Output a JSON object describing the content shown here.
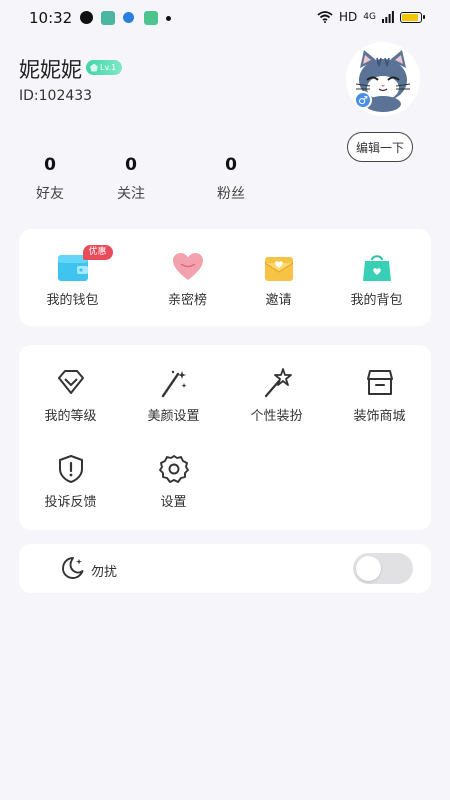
{
  "status_bar": {
    "time": "10:32",
    "network": "HD",
    "signal": "4G",
    "battery_level": 0.9,
    "battery_color": "#f4c400"
  },
  "profile": {
    "username": "妮妮妮",
    "level": "Lv.1",
    "user_id": "ID:102433",
    "gender_symbol": "♂",
    "edit_label": "编辑一下"
  },
  "stats": [
    {
      "value": "0",
      "label": "好友"
    },
    {
      "value": "0",
      "label": "关注"
    },
    {
      "value": "0",
      "label": "粉丝"
    }
  ],
  "quick_menu": {
    "items": [
      {
        "label": "我的钱包",
        "icon": "wallet-icon",
        "badge": "优惠"
      },
      {
        "label": "亲密榜",
        "icon": "heart-icon"
      },
      {
        "label": "邀请",
        "icon": "envelope-icon"
      },
      {
        "label": "我的背包",
        "icon": "bag-icon"
      }
    ]
  },
  "settings_menu": {
    "items": [
      {
        "label": "我的等级",
        "icon": "diamond-icon"
      },
      {
        "label": "美颜设置",
        "icon": "magic-wand-icon"
      },
      {
        "label": "个性装扮",
        "icon": "star-wand-icon"
      },
      {
        "label": "装饰商城",
        "icon": "store-icon"
      },
      {
        "label": "投诉反馈",
        "icon": "shield-alert-icon"
      },
      {
        "label": "设置",
        "icon": "gear-icon"
      }
    ]
  },
  "do_not_disturb": {
    "label": "勿扰",
    "enabled": false
  },
  "colors": {
    "background": "#f6f5f9",
    "accent_green": "#3fd6a6",
    "badge_red": "#ea4b5a",
    "toggle_off": "#e1e1e4"
  }
}
